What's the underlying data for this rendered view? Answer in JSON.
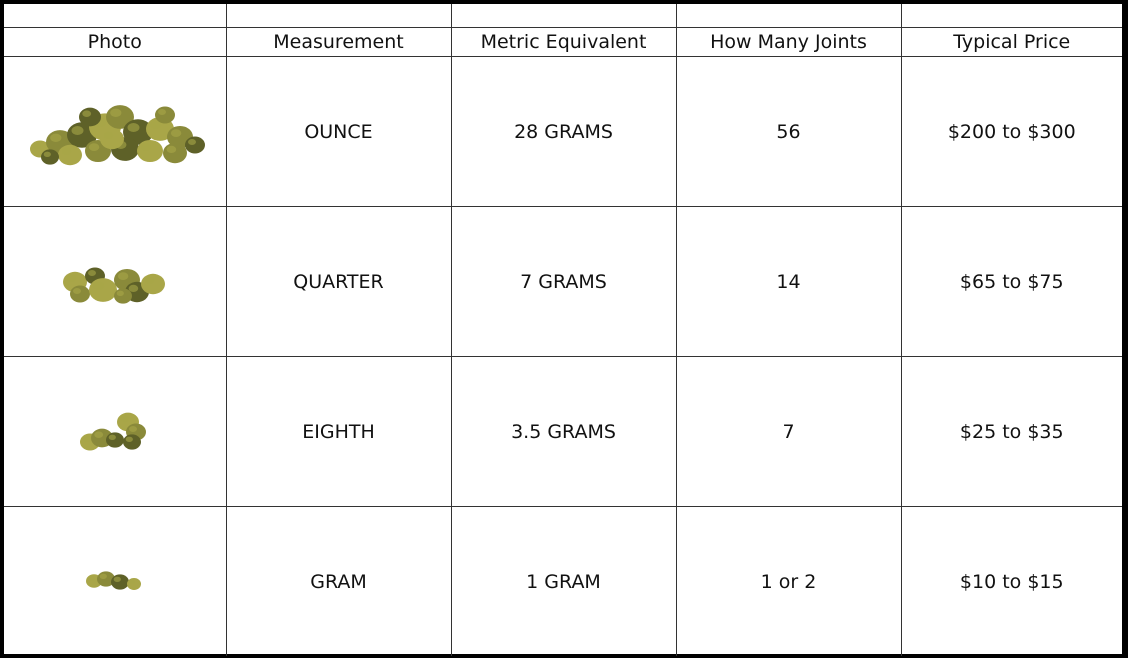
{
  "table": {
    "headers": [
      "Photo",
      "Measurement",
      "Metric Equivalent",
      "How Many Joints",
      "Typical Price"
    ],
    "rows": [
      {
        "photo_icon": "cannabis-pile-large-icon",
        "measurement": "OUNCE",
        "metric": "28 GRAMS",
        "joints": "56",
        "price": "$200 to $300"
      },
      {
        "photo_icon": "cannabis-pile-medium-icon",
        "measurement": "QUARTER",
        "metric": "7 GRAMS",
        "joints": "14",
        "price": "$65 to $75"
      },
      {
        "photo_icon": "cannabis-pile-small-icon",
        "measurement": "EIGHTH",
        "metric": "3.5 GRAMS",
        "joints": "7",
        "price": "$25 to $35"
      },
      {
        "photo_icon": "cannabis-pile-tiny-icon",
        "measurement": "GRAM",
        "metric": "1 GRAM",
        "joints": "1 or 2",
        "price": "$10 to $15"
      }
    ]
  },
  "colors": {
    "bud": "#8a8a3a",
    "bud_light": "#a9a648",
    "bud_dark": "#5e6128",
    "border": "#000000"
  }
}
